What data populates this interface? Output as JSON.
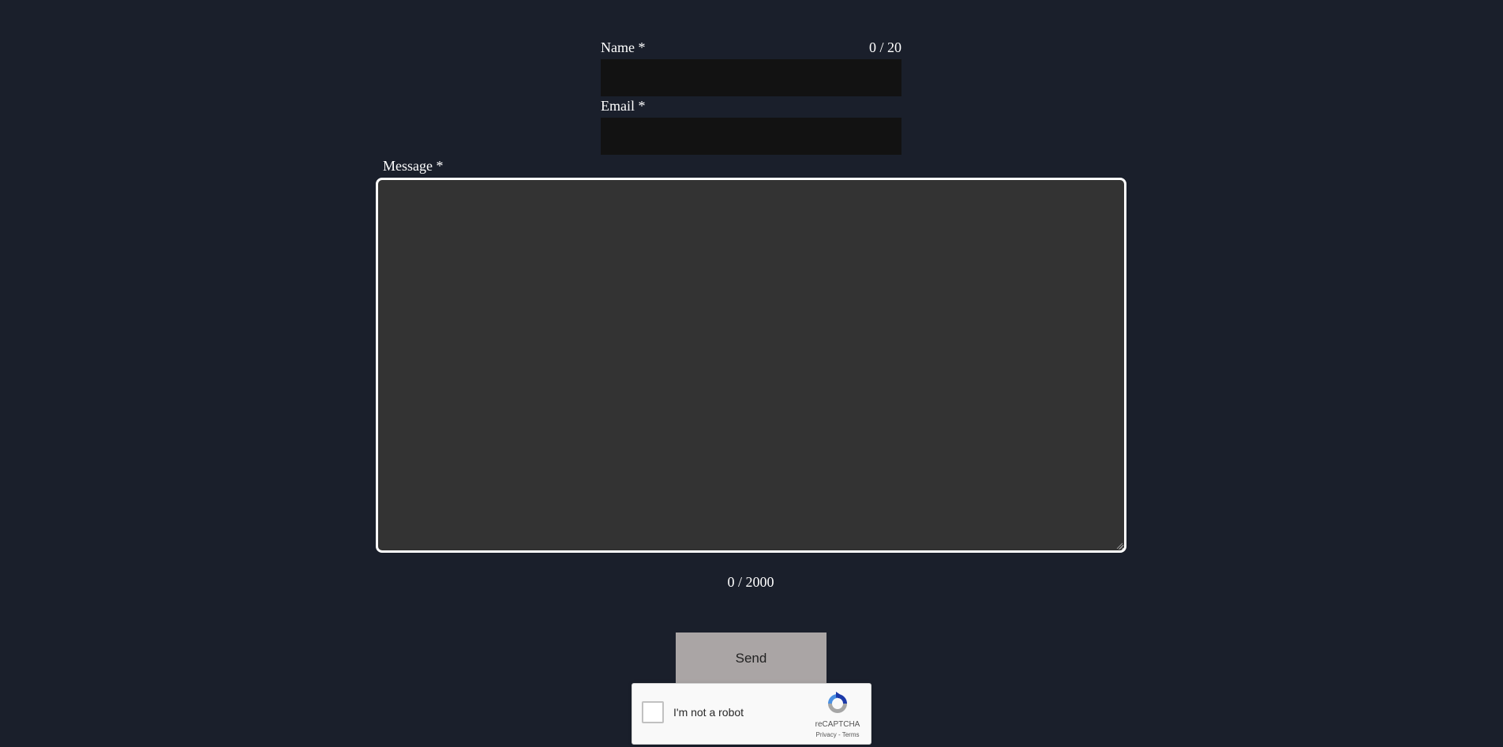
{
  "form": {
    "name": {
      "label": "Name *",
      "value": "",
      "counter": "0 / 20"
    },
    "email": {
      "label": "Email *",
      "value": ""
    },
    "message": {
      "label": "Message *",
      "value": "",
      "counter": "0 / 2000"
    },
    "send_label": "Send"
  },
  "recaptcha": {
    "label": "I'm not a robot",
    "brand": "reCAPTCHA",
    "privacy": "Privacy",
    "separator": " - ",
    "terms": "Terms",
    "icon": "recaptcha-logo-icon"
  },
  "colors": {
    "background": "#1a1f2b",
    "input_background": "#121212",
    "textarea_background": "#333333",
    "button_background": "#aaa5a5"
  }
}
